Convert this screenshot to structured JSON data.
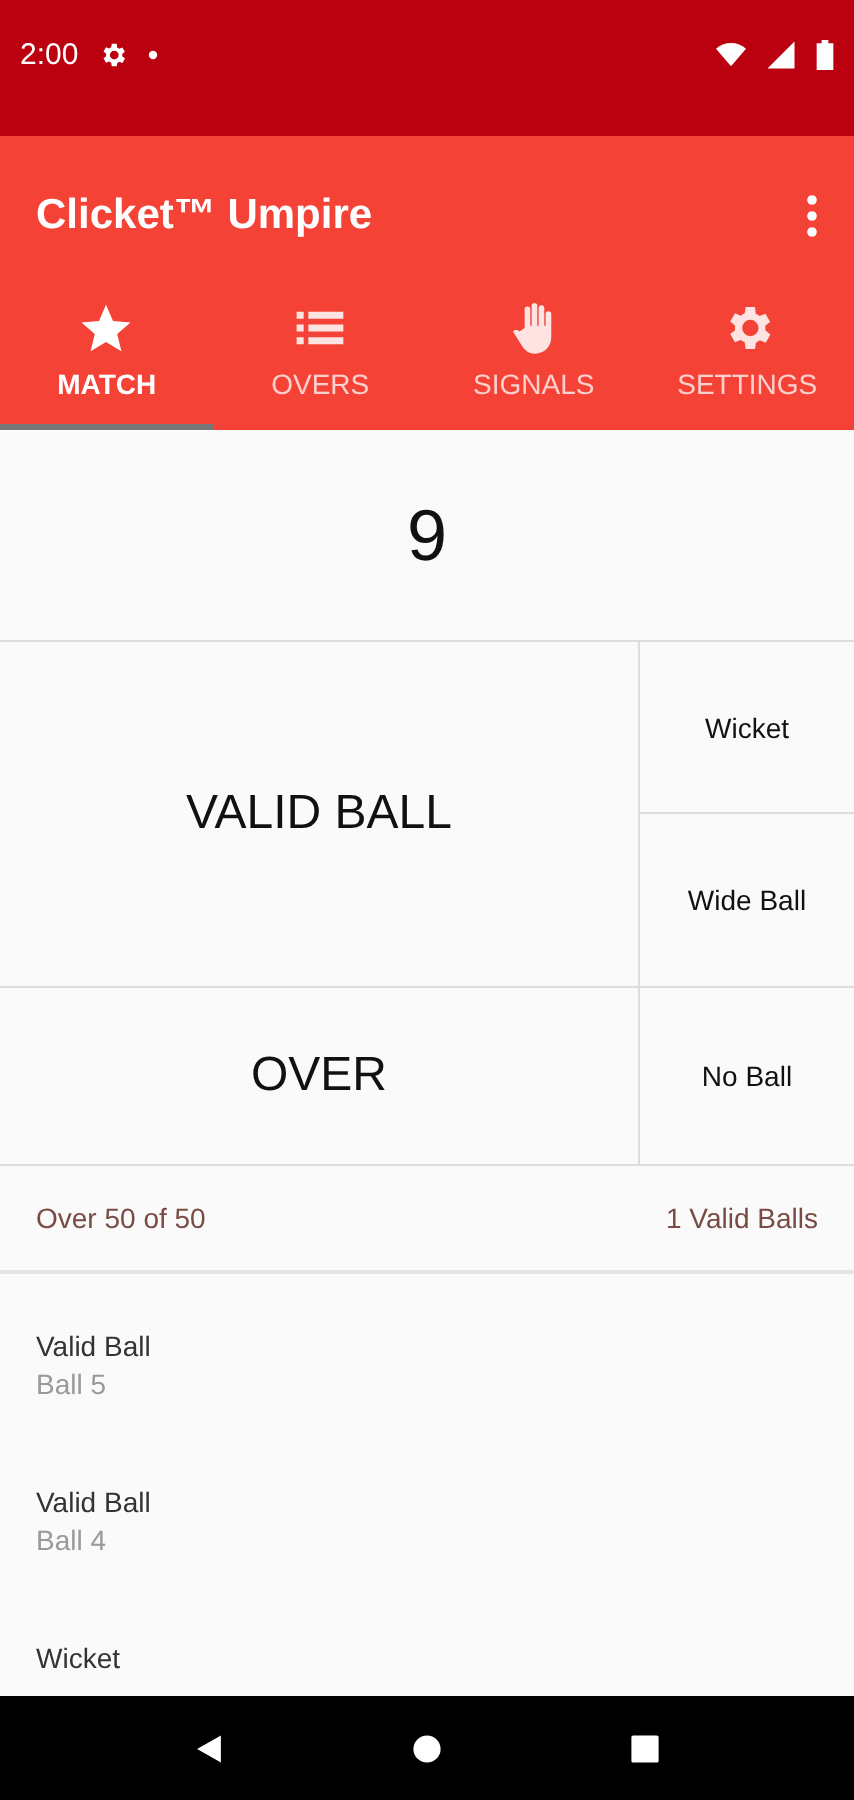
{
  "status_bar": {
    "time": "2:00"
  },
  "app_bar": {
    "title": "Clicket™ Umpire"
  },
  "tabs": [
    {
      "label": "MATCH",
      "kind": "star",
      "selected": true
    },
    {
      "label": "OVERS",
      "kind": "list",
      "selected": false
    },
    {
      "label": "SIGNALS",
      "kind": "hand",
      "selected": false
    },
    {
      "label": "SETTINGS",
      "kind": "gear",
      "selected": false
    }
  ],
  "count": "9",
  "buttons": {
    "valid_ball": "VALID BALL",
    "over": "OVER",
    "wicket": "Wicket",
    "wide_ball": "Wide Ball",
    "no_ball": "No Ball"
  },
  "summary": {
    "over": "Over 50 of 50",
    "valid_balls": "1 Valid Balls"
  },
  "balls": [
    {
      "title": "Valid Ball",
      "subtitle": "Ball 5"
    },
    {
      "title": "Valid Ball",
      "subtitle": "Ball 4"
    },
    {
      "title": "Wicket"
    }
  ]
}
